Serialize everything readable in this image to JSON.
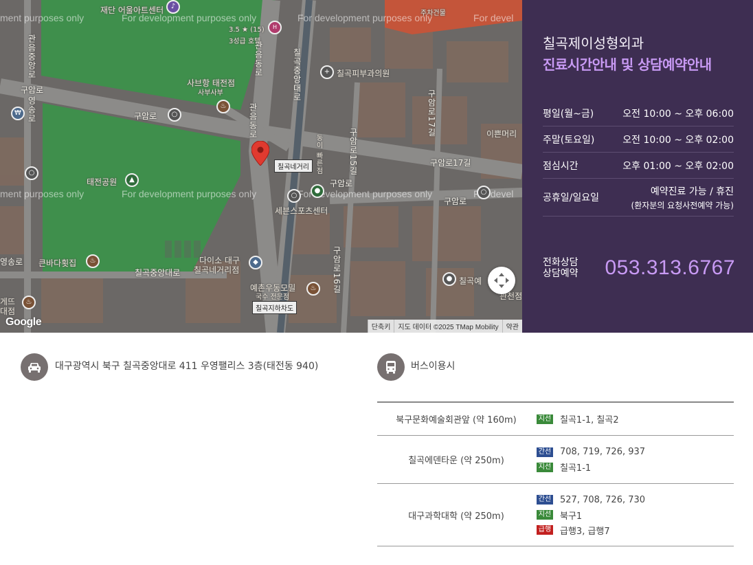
{
  "map": {
    "watermark": "For development purposes only",
    "watermark_partial_left": "ment purposes only",
    "watermark_partial_right": "For devel",
    "labels": {
      "top_center": "재단 어울아트센터",
      "rating": "3.5 ★ (15)",
      "hotel": "3성급 호텔",
      "parking": "주차건물",
      "skin_clinic": "칠곡피부과의원",
      "saebuhang": "사브항 태전점",
      "saebuhang_sub": "사부사부",
      "guamro_top": "구암로",
      "guamro_mid": "구암로",
      "guamro_right": "구암로",
      "guamro_far": "구암로",
      "guamro17": "구암로17길",
      "ippeun": "이쁜머리",
      "taejeon_park": "태전공원",
      "chilgok_intersection": "칠곡네거리",
      "seven_sports": "세븐스포츠센터",
      "bigtree": "큰바다횟집",
      "chilgok_central": "칠곡중앙대로",
      "daiso": "다이소 대구",
      "daiso_sub": "칠곡네거리점",
      "yechan": "예촌우동모밀",
      "yechan_sub": "국수 전문점",
      "underpass": "칠곡지하차도",
      "yeongsongro": "영송로",
      "gatedu": "게뜨",
      "gatedu_sub": "대점",
      "chilgok_right": "칠곡예",
      "chilgok_right2": "관천점",
      "road_v_center": "칠곡중앙대로",
      "road_v_left": "관음동로",
      "road_v_left2": "관음동로",
      "road_v_guam15": "구암로15길",
      "road_v_guam16": "구암로16길",
      "road_v_guam17": "구암로17길",
      "road_v_far_left": "관음중앙로",
      "road_v_far_left2": "영송로",
      "dong_label": "동이 빠른점"
    },
    "footer": {
      "shortcut": "단축키",
      "map_data": "지도 데이터 ©2025 TMap Mobility",
      "terms": "약관"
    },
    "google": "Google"
  },
  "info": {
    "clinic_name": "칠곡제이성형외과",
    "subtitle": "진료시간안내 및 상담예약안내",
    "hours": [
      {
        "day": "평일(월~금)",
        "time": "오전 10:00 ~ 오후 06:00"
      },
      {
        "day": "주말(토요일)",
        "time": "오전 10:00 ~ 오후 02:00"
      },
      {
        "day": "점심시간",
        "time": "오후 01:00 ~ 오후 02:00"
      },
      {
        "day": "공휴일/일요일",
        "time": "예약진료 가능 / 휴진",
        "sub": "(환자분의 요청사전예약 가능)"
      }
    ],
    "phone_label_1": "전화상담",
    "phone_label_2": "상담예약",
    "phone_number": "053.313.6767"
  },
  "address": {
    "text": "대구광역시 북구 칠곡중앙대로 411 우영팰리스 3층(태전동 940)"
  },
  "bus": {
    "title": "버스이용시",
    "stops": [
      {
        "name": "북구문화예술회관앞 (약 160m)",
        "routes": [
          {
            "type": "branch",
            "tag": "지선",
            "lines": "칠곡1-1, 칠곡2"
          }
        ]
      },
      {
        "name": "칠곡에덴타운 (약 250m)",
        "routes": [
          {
            "type": "trunk",
            "tag": "간선",
            "lines": "708, 719, 726, 937"
          },
          {
            "type": "branch",
            "tag": "지선",
            "lines": "칠곡1-1"
          }
        ]
      },
      {
        "name": "대구과학대학 (약 250m)",
        "routes": [
          {
            "type": "trunk",
            "tag": "간선",
            "lines": "527, 708, 726, 730"
          },
          {
            "type": "branch",
            "tag": "지선",
            "lines": "북구1"
          },
          {
            "type": "express",
            "tag": "급행",
            "lines": "급행3, 급행7"
          }
        ]
      }
    ]
  },
  "colors": {
    "panel_bg": "#3e2e52",
    "accent_purple": "#c89af4",
    "tag_branch": "#3a8a3a",
    "tag_trunk": "#2d4e91",
    "tag_express": "#c2201f"
  }
}
